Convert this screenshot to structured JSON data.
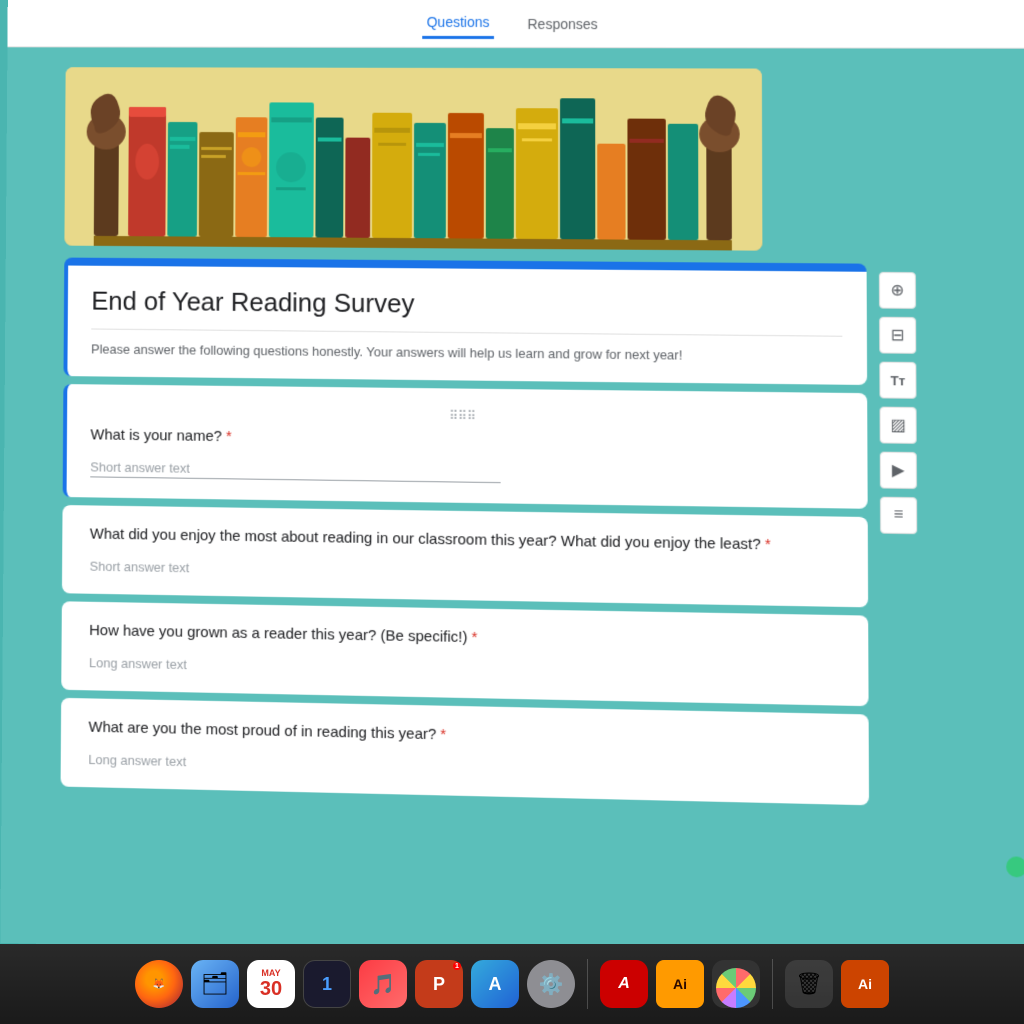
{
  "tabs": {
    "questions_label": "Questions",
    "responses_label": "Responses",
    "active_tab": "questions"
  },
  "survey": {
    "title": "End of Year Reading Survey",
    "description": "Please answer the following questions honestly. Your answers will help us learn and grow for next year!"
  },
  "questions": [
    {
      "id": 1,
      "text": "What is your name?",
      "type": "short",
      "placeholder": "Short answer text",
      "required": true,
      "active": true
    },
    {
      "id": 2,
      "text": "What did you enjoy the most about reading in our classroom this year? What did you enjoy the least?",
      "type": "short",
      "placeholder": "Short answer text",
      "required": true,
      "active": false
    },
    {
      "id": 3,
      "text": "How have you grown as a reader this year? (Be specific!)",
      "type": "long",
      "placeholder": "Long answer text",
      "required": true,
      "active": false
    },
    {
      "id": 4,
      "text": "What are you the most proud of in reading this year?",
      "type": "long",
      "placeholder": "Long answer text",
      "required": true,
      "active": false
    }
  ],
  "sidebar_tools": [
    {
      "name": "add",
      "icon": "⊕"
    },
    {
      "name": "section",
      "icon": "⊟"
    },
    {
      "name": "text",
      "icon": "Tт"
    },
    {
      "name": "image",
      "icon": "▨"
    },
    {
      "name": "video",
      "icon": "▶"
    },
    {
      "name": "grid",
      "icon": "⊞"
    }
  ],
  "dock": {
    "items": [
      {
        "name": "Firefox",
        "type": "firefox"
      },
      {
        "name": "Finder",
        "type": "finder"
      },
      {
        "name": "Calendar",
        "type": "calendar",
        "date": "30",
        "month": "MAY"
      },
      {
        "name": "1Password",
        "type": "onepw",
        "label": "1"
      },
      {
        "name": "Music",
        "type": "music"
      },
      {
        "name": "PowerPoint",
        "type": "powerpoint",
        "label": "P"
      },
      {
        "name": "App Store",
        "type": "appstore"
      },
      {
        "name": "Settings",
        "type": "settings"
      },
      {
        "name": "Acrobat",
        "type": "acrobat",
        "label": "A"
      },
      {
        "name": "Illustrator",
        "type": "illustrator",
        "label": "Ai"
      },
      {
        "name": "Photos",
        "type": "photos"
      },
      {
        "name": "Trash",
        "type": "trash"
      }
    ]
  }
}
